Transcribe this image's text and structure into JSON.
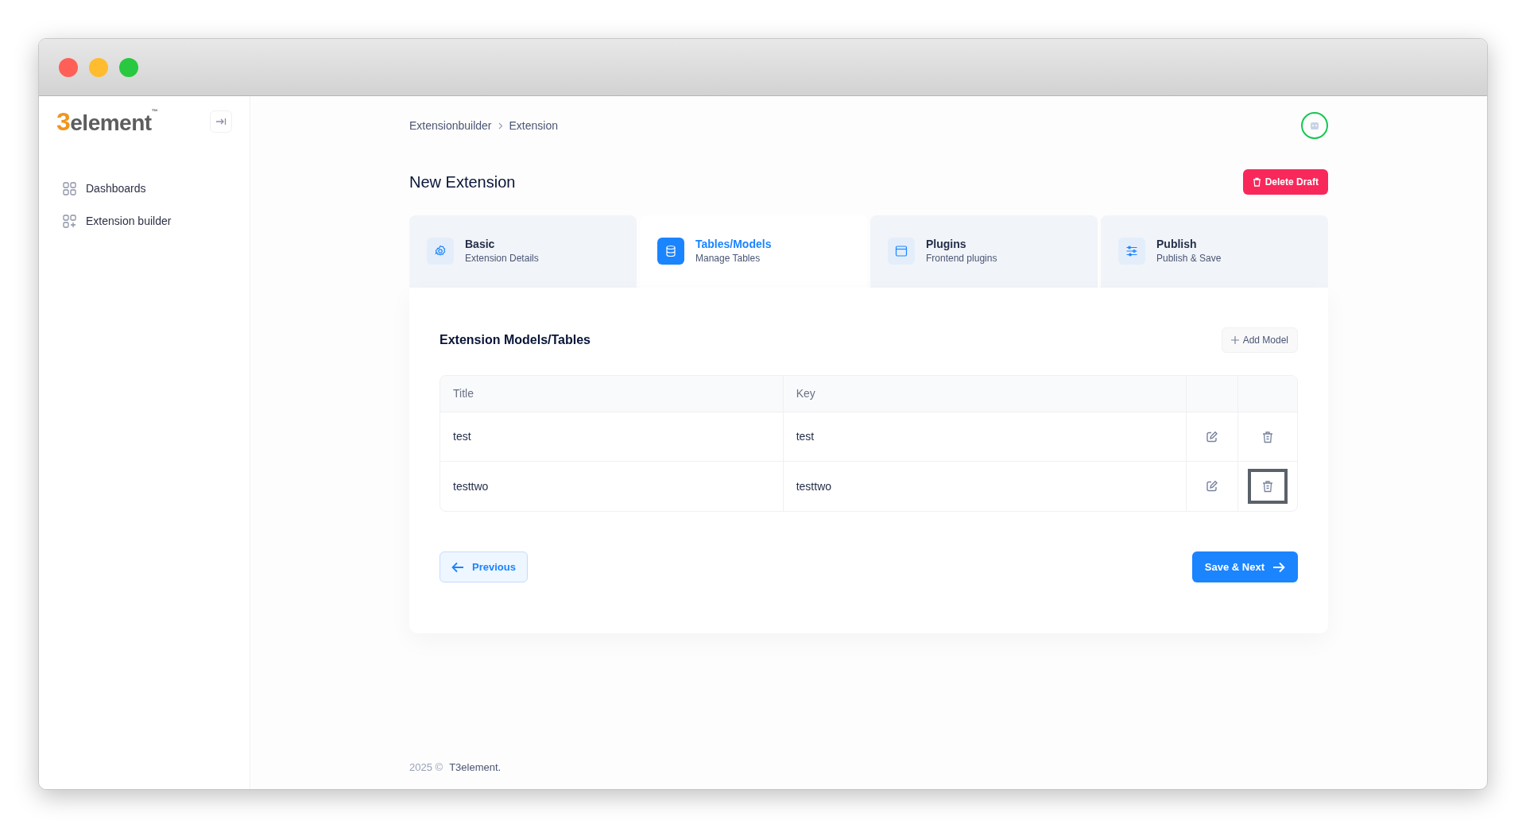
{
  "window": {
    "controls": [
      {
        "color": "#ff5f57"
      },
      {
        "color": "#febc2e"
      },
      {
        "color": "#28c840"
      }
    ]
  },
  "logo": {
    "mark": "3",
    "text": "element",
    "tm": "™"
  },
  "sidebar": {
    "items": [
      {
        "label": "Dashboards",
        "kind": "grid",
        "selected": false
      },
      {
        "label": "Extension builder",
        "kind": "grid-plus",
        "selected": false
      }
    ]
  },
  "breadcrumb": [
    "Extensionbuilder",
    "Extension"
  ],
  "page_title": "New Extension",
  "delete_draft_button": "Delete Draft",
  "steps": [
    {
      "title": "Basic",
      "subtitle": "Extension Details",
      "kind": "gear",
      "selected": false
    },
    {
      "title": "Tables/Models",
      "subtitle": "Manage Tables",
      "kind": "database",
      "selected": true
    },
    {
      "title": "Plugins",
      "subtitle": "Frontend plugins",
      "kind": "window",
      "selected": false
    },
    {
      "title": "Publish",
      "subtitle": "Publish & Save",
      "kind": "sliders",
      "selected": false
    }
  ],
  "section_title": "Extension Models/Tables",
  "add_model_button": "Add Model",
  "table": {
    "columns": [
      "Title",
      "Key"
    ],
    "rows": [
      {
        "title": "test",
        "key": "test",
        "delete_focused": false
      },
      {
        "title": "testtwo",
        "key": "testtwo",
        "delete_focused": true
      }
    ]
  },
  "previous_button": "Previous",
  "next_button": "Save & Next",
  "footer": {
    "year": "2025 ©",
    "company": "T3element."
  }
}
